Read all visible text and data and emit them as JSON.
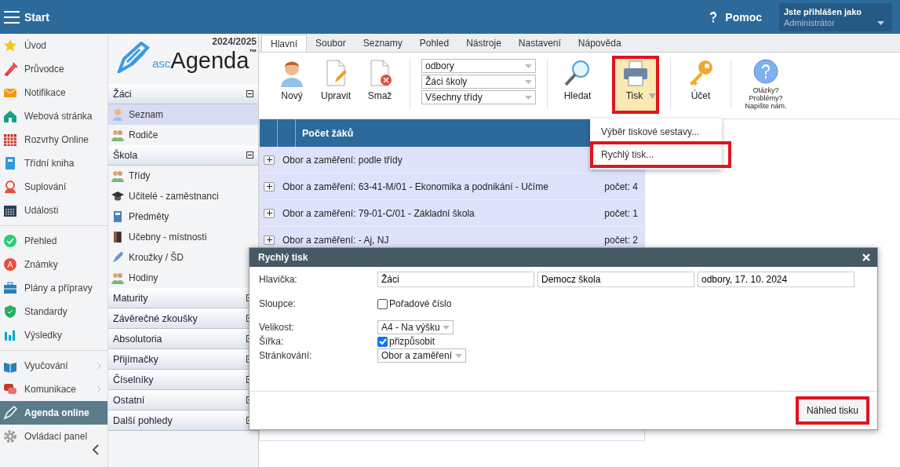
{
  "top_bar": {
    "title": "Start",
    "help": "Pomoc",
    "user_label": "Jste přihlášen jako",
    "user_name": "Administrátor"
  },
  "nav": {
    "groups": [
      [
        {
          "label": "Úvod",
          "selected": false,
          "submenu": false
        },
        {
          "label": "Průvodce",
          "selected": false,
          "submenu": false
        },
        {
          "label": "Notifikace",
          "selected": false,
          "submenu": false
        },
        {
          "label": "Webová stránka",
          "selected": false,
          "submenu": false
        },
        {
          "label": "Rozvrhy Online",
          "selected": false,
          "submenu": false
        },
        {
          "label": "Třídní kniha",
          "selected": false,
          "submenu": false
        },
        {
          "label": "Suplování",
          "selected": false,
          "submenu": false
        },
        {
          "label": "Události",
          "selected": false,
          "submenu": false
        }
      ],
      [
        {
          "label": "Přehled",
          "selected": false,
          "submenu": false
        },
        {
          "label": "Známky",
          "selected": false,
          "submenu": false
        },
        {
          "label": "Plány a přípravy",
          "selected": false,
          "submenu": false
        },
        {
          "label": "Standardy",
          "selected": false,
          "submenu": false
        },
        {
          "label": "Výsledky",
          "selected": false,
          "submenu": false
        }
      ],
      [
        {
          "label": "Vyučování",
          "selected": false,
          "submenu": true
        },
        {
          "label": "Komunikace",
          "selected": false,
          "submenu": true
        },
        {
          "label": "Agenda online",
          "selected": true,
          "submenu": false
        },
        {
          "label": "Ovládací panel",
          "selected": false,
          "submenu": false
        }
      ]
    ]
  },
  "sidebar": {
    "year": "2024/2025",
    "logo_prefix": "asc",
    "logo_name": "Agenda",
    "logo_mark": "™",
    "sections": [
      {
        "label": "Žáci",
        "expanded": true,
        "items": [
          {
            "label": "Seznam",
            "selected": true
          },
          {
            "label": "Rodiče",
            "selected": false
          }
        ]
      },
      {
        "label": "Škola",
        "expanded": true,
        "items": [
          {
            "label": "Třídy",
            "selected": false
          },
          {
            "label": "Učitelé - zaměstnanci",
            "selected": false
          },
          {
            "label": "Předměty",
            "selected": false
          },
          {
            "label": "Učebny - místnosti",
            "selected": false
          },
          {
            "label": "Kroužky / ŠD",
            "selected": false
          },
          {
            "label": "Hodiny",
            "selected": false
          }
        ]
      },
      {
        "label": "Maturity",
        "expanded": false
      },
      {
        "label": "Závěrečné zkoušky",
        "expanded": false
      },
      {
        "label": "Absolutoria",
        "expanded": false
      },
      {
        "label": "Přijímačky",
        "expanded": false
      },
      {
        "label": "Číselníky",
        "expanded": false
      },
      {
        "label": "Ostatní",
        "expanded": false
      },
      {
        "label": "Další pohledy",
        "expanded": false
      }
    ]
  },
  "tabs": [
    {
      "label": "Hlavní",
      "selected": true
    },
    {
      "label": "Soubor",
      "selected": false
    },
    {
      "label": "Seznamy",
      "selected": false
    },
    {
      "label": "Pohled",
      "selected": false
    },
    {
      "label": "Nástroje",
      "selected": false
    },
    {
      "label": "Nastavení",
      "selected": false
    },
    {
      "label": "Nápověda",
      "selected": false
    }
  ],
  "ribbon": {
    "left_buttons": [
      {
        "label": "Nový",
        "highlighted": false
      },
      {
        "label": "Upravit",
        "highlighted": false
      },
      {
        "label": "Smaž",
        "highlighted": false
      }
    ],
    "filters": [
      {
        "value": "odbory"
      },
      {
        "value": "Žáci školy"
      },
      {
        "value": "Všechny třídy"
      }
    ],
    "right_buttons": [
      {
        "label": "Hledat",
        "highlighted": false,
        "dropdown": false
      },
      {
        "label": "Tisk",
        "highlighted": true,
        "dropdown": true
      },
      {
        "label": "Účet",
        "highlighted": false,
        "dropdown": false
      }
    ],
    "help_lines": [
      "Otázky?",
      "Problémy?",
      "Napište nám."
    ]
  },
  "grid": {
    "columns": [
      "Počet žáků"
    ],
    "rows": [
      {
        "text": "Obor a zaměření: podle třídy"
      },
      {
        "text": "Obor a zaměření: 63-41-M/01 - Ekonomika a podnikání - Učíme",
        "count": "počet: 4"
      },
      {
        "text": "Obor a zaměření: 79-01-C/01 - Základní škola",
        "count": "počet: 1"
      },
      {
        "text": "Obor a zaměření: - Aj, NJ",
        "count": "počet: 2"
      }
    ]
  },
  "print_menu": {
    "items": [
      {
        "label": "Výběr tiskové sestavy...",
        "highlighted": false
      },
      {
        "label": "Rychlý tisk...",
        "highlighted": true
      }
    ]
  },
  "dialog": {
    "title": "Rychlý tisk",
    "header_label": "Hlavička:",
    "header_fields": [
      "Žáci",
      "Democz škola",
      "odbory, 17. 10. 2024"
    ],
    "columns_label": "Sloupce:",
    "columns_option": {
      "label": "Pořadové číslo",
      "checked": false
    },
    "size_label": "Velikost:",
    "size_value": "A4 - Na výšku",
    "width_label": "Šířka:",
    "width_option": {
      "label": "přizpůsobit",
      "checked": true
    },
    "paging_label": "Stránkování:",
    "paging_value": "Obor a zaměření",
    "preview_button": {
      "label": "Náhled tisku",
      "highlighted": true
    }
  }
}
